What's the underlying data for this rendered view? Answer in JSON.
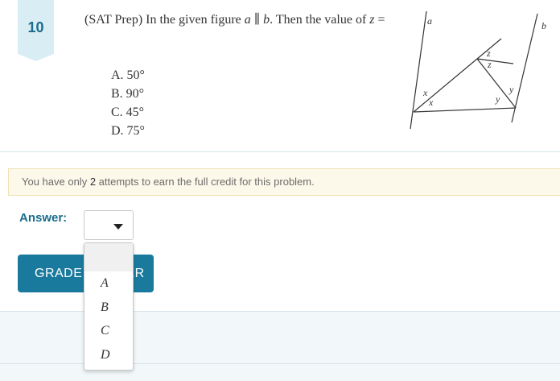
{
  "problem": {
    "number": "10",
    "text_prefix": "(SAT Prep) In the given figure ",
    "text_math": "a ∥ b",
    "text_suffix": ". Then the value of ",
    "text_var": "z",
    "text_eq": " =",
    "choices": [
      "A. 50°",
      "B. 90°",
      "C. 45°",
      "D. 75°"
    ]
  },
  "figure": {
    "labels": {
      "a": "a",
      "b": "b",
      "x": "x",
      "y": "y",
      "z": "z"
    }
  },
  "attempts": {
    "before": "You have only ",
    "count": "2",
    "after": " attempts to earn the full credit for this problem."
  },
  "answer": {
    "label": "Answer:",
    "selected": "",
    "options": [
      "",
      "A",
      "B",
      "C",
      "D"
    ]
  },
  "grade_button": {
    "label": "GRADE ANSWER"
  },
  "colors": {
    "accent": "#1a7a9e",
    "badge_bg": "#d9edf4",
    "notice_bg": "#fdf9ea"
  }
}
